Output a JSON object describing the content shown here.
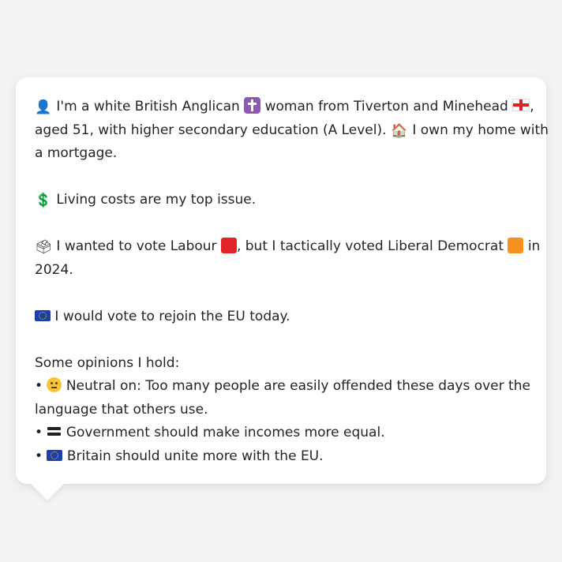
{
  "profile": {
    "line1": {
      "person_icon": "person-silhouette-icon",
      "a": "I'm a white British Anglican",
      "cross_icon": "latin-cross-icon",
      "b": "woman from Tiverton and Minehead",
      "flag_icon": "england-flag-icon",
      "c": ","
    },
    "line2": {
      "a": "aged 51, with higher secondary education (A Level).",
      "house_icon": "house-icon",
      "b": "I own my home with"
    },
    "line3": "a mortgage.",
    "issue": {
      "icon": "dollar-icon",
      "text": "Living costs are my top issue."
    },
    "vote": {
      "ballot_icon": "ballot-box-icon",
      "a": "I wanted to vote Labour",
      "labour_color": "#e0242a",
      "b": ", but I tactically voted Liberal Democrat",
      "libdem_color": "#f7901e",
      "c": "in",
      "d": "2024."
    },
    "eu": {
      "icon": "eu-flag-icon",
      "text": "I would vote to rejoin the EU today."
    },
    "opinions_heading": "Some opinions I hold:",
    "opinions": [
      {
        "bullet": "•",
        "icon": "neutral-face-icon",
        "line1": "Neutral on: Too many people are easily offended these days over the",
        "line2": "language that others use."
      },
      {
        "bullet": "•",
        "icon": "equals-icon",
        "line1": "Government should make incomes more equal."
      },
      {
        "bullet": "•",
        "icon": "eu-flag-icon",
        "line1": "Britain should unite more with the EU."
      }
    ]
  }
}
